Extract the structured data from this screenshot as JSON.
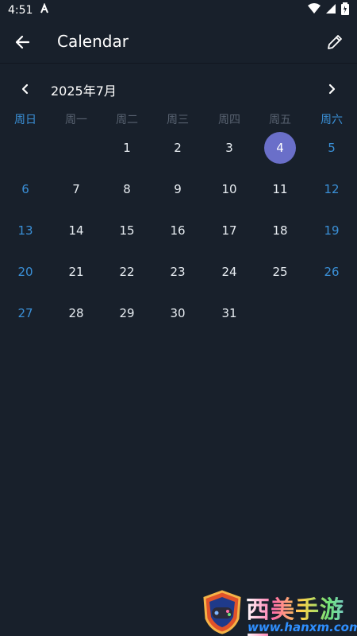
{
  "status_bar": {
    "time": "4:51"
  },
  "app_bar": {
    "title": "Calendar"
  },
  "calendar": {
    "month_label": "2025年7月",
    "weekdays": [
      "周日",
      "周一",
      "周二",
      "周三",
      "周四",
      "周五",
      "周六"
    ],
    "first_weekday_index": 2,
    "days_in_month": 31,
    "selected_day": 4
  },
  "colors": {
    "background": "#18202b",
    "weekend": "#3a8fd6",
    "weekday_header": "#586270",
    "selected": "#6a6fc9"
  },
  "watermark": {
    "title": "西美手游网",
    "subtitle": "www.hanxm.com"
  }
}
